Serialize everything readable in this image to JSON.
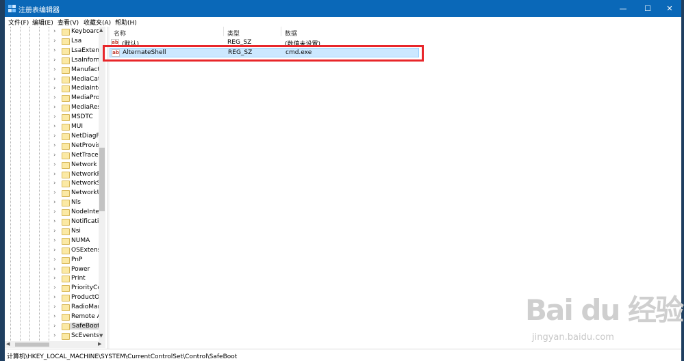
{
  "window": {
    "title": "注册表编辑器",
    "minimize": "—",
    "maximize": "☐",
    "close": "✕"
  },
  "menu": [
    "文件(F)",
    "编辑(E)",
    "查看(V)",
    "收藏夹(A)",
    "帮助(H)"
  ],
  "tree": {
    "items": [
      {
        "label": "Keyboard"
      },
      {
        "label": "Lsa"
      },
      {
        "label": "LsaExtens"
      },
      {
        "label": "LsaInform"
      },
      {
        "label": "Manufactu"
      },
      {
        "label": "MediaCat"
      },
      {
        "label": "MediaInte"
      },
      {
        "label": "MediaPro"
      },
      {
        "label": "MediaRes"
      },
      {
        "label": "MSDTC"
      },
      {
        "label": "MUI"
      },
      {
        "label": "NetDiagFx"
      },
      {
        "label": "NetProvis"
      },
      {
        "label": "NetTrace"
      },
      {
        "label": "Network"
      },
      {
        "label": "NetworkP"
      },
      {
        "label": "NetworkS"
      },
      {
        "label": "NetworkU"
      },
      {
        "label": "Nls"
      },
      {
        "label": "NodeInter"
      },
      {
        "label": "Notificati"
      },
      {
        "label": "Nsi"
      },
      {
        "label": "NUMA"
      },
      {
        "label": "OSExtensi"
      },
      {
        "label": "PnP"
      },
      {
        "label": "Power"
      },
      {
        "label": "Print"
      },
      {
        "label": "PriorityCo"
      },
      {
        "label": "ProductOp"
      },
      {
        "label": "RadioMar"
      },
      {
        "label": "Remote A"
      },
      {
        "label": "SafeBoot",
        "selected": true
      },
      {
        "label": "ScEvents"
      }
    ]
  },
  "list": {
    "columns": [
      "名称",
      "类型",
      "数据"
    ],
    "rows": [
      {
        "name": "(默认)",
        "type": "REG_SZ",
        "data": "(数值未设置)"
      },
      {
        "name": "AlternateShell",
        "type": "REG_SZ",
        "data": "cmd.exe"
      }
    ]
  },
  "status": {
    "path": "计算机\\HKEY_LOCAL_MACHINE\\SYSTEM\\CurrentControlSet\\Control\\SafeBoot"
  },
  "watermark": {
    "logo": "Bai du 经验",
    "url": "jingyan.baidu.com"
  },
  "colors": {
    "titlebar": "#0a68b8",
    "selection": "#cce8ff",
    "highlight": "#e8262a"
  }
}
